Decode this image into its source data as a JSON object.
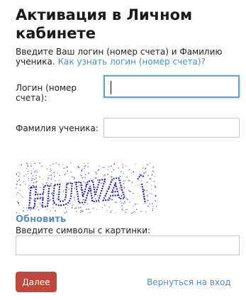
{
  "title": "Активация в Личном кабинете",
  "intro": {
    "text": "Введите Ваш логин (номер счета) и Фамилию ученика.",
    "link": "Как узнать логин (номер счета)?"
  },
  "form": {
    "login_label": "Логин (номер счета):",
    "login_value": "",
    "surname_label": "Фамилия ученика:",
    "surname_value": "",
    "captcha_text": "HUWA",
    "refresh_label": "Обновить",
    "captcha_label": "Введите символы с картинки:",
    "captcha_value": ""
  },
  "actions": {
    "next_label": "Далее",
    "back_label": "Вернуться на вход"
  },
  "colors": {
    "primary_button": "#c0473b",
    "link": "#4a8fc7",
    "focus_border": "#6a9ed6",
    "captcha_ink": "#1b1fa8"
  }
}
